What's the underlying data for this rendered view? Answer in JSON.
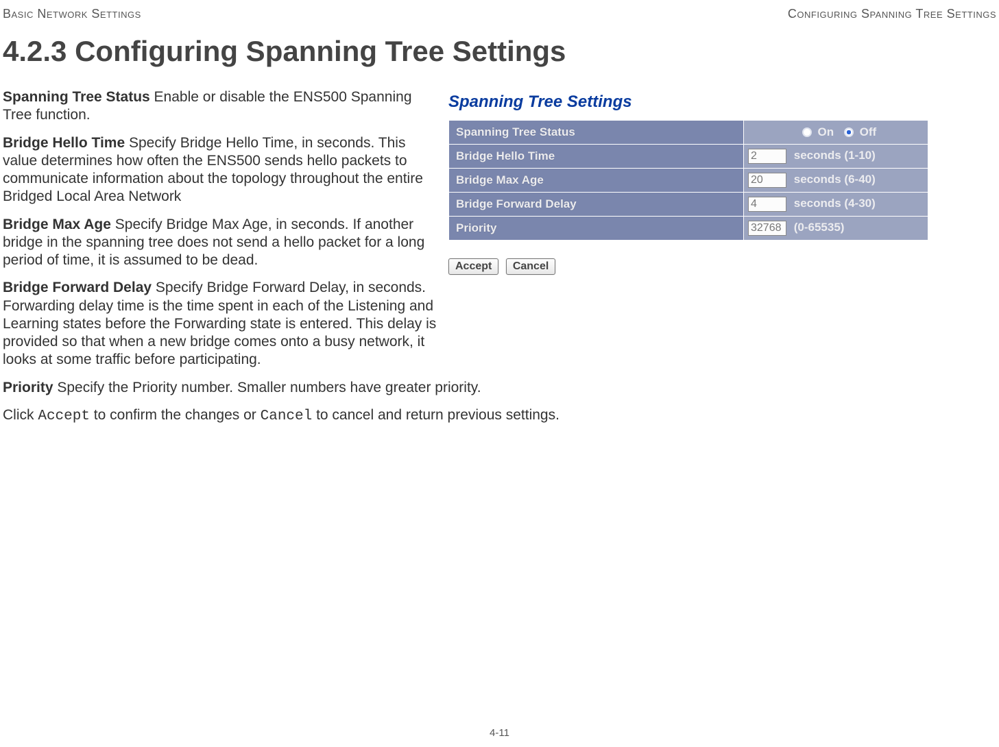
{
  "header": {
    "left": "Basic Network Settings",
    "right": "Configuring Spanning Tree Settings"
  },
  "title": "4.2.3 Configuring Spanning Tree Settings",
  "paragraphs": {
    "p1_term": "Spanning Tree Status",
    "p1_text": "  Enable or disable the ENS500 Spanning Tree function.",
    "p2_term": "Bridge Hello Time",
    "p2_text": "  Specify Bridge Hello Time, in seconds. This value determines how often the ENS500 sends hello packets to communicate information about the topology throughout the entire Bridged Local Area Network",
    "p3_term": "Bridge Max Age",
    "p3_text": "  Specify Bridge Max Age, in seconds. If another bridge in the spanning tree does not send a hello packet for a long period of time, it is assumed to be dead.",
    "p4_term": "Bridge Forward Delay",
    "p4_text": "  Specify Bridge Forward Delay, in seconds. Forwarding delay time is the time spent in each of the Listening and Learning states before the Forwarding state is entered. This delay is provided so that when a new bridge comes onto a busy network, it looks at some traffic before participating.",
    "p5_term": "Priority",
    "p5_text": "  Specify the Priority number. Smaller numbers have greater priority.",
    "p6_pre": "Click ",
    "p6_accept": "Accept",
    "p6_mid": " to confirm the changes or ",
    "p6_cancel": "Cancel",
    "p6_post": " to cancel and return previous settings."
  },
  "screenshot": {
    "title": "Spanning Tree Settings",
    "rows": {
      "status_label": "Spanning Tree Status",
      "status_on": "On",
      "status_off": "Off",
      "hello_label": "Bridge Hello Time",
      "hello_value": "2",
      "hello_unit": "seconds (1-10)",
      "maxage_label": "Bridge Max Age",
      "maxage_value": "20",
      "maxage_unit": "seconds (6-40)",
      "fwd_label": "Bridge Forward Delay",
      "fwd_value": "4",
      "fwd_unit": "seconds (4-30)",
      "prio_label": "Priority",
      "prio_value": "32768",
      "prio_unit": "(0-65535)"
    },
    "buttons": {
      "accept": "Accept",
      "cancel": "Cancel"
    }
  },
  "page_number": "4-11"
}
